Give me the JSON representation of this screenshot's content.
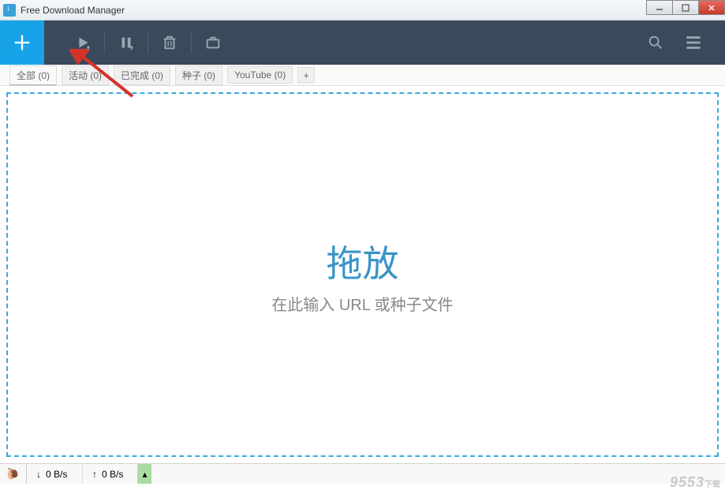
{
  "window": {
    "title": "Free Download Manager"
  },
  "toolbar": {
    "add": "add",
    "play": "start",
    "pause": "pause",
    "delete": "delete",
    "archive": "archive",
    "search": "search",
    "menu": "menu"
  },
  "tabs": [
    {
      "label": "全部 (0)",
      "active": true
    },
    {
      "label": "活动 (0)",
      "active": false
    },
    {
      "label": "已完成 (0)",
      "active": false
    },
    {
      "label": "种子 (0)",
      "active": false
    },
    {
      "label": "YouTube (0)",
      "active": false
    }
  ],
  "tab_add": "+",
  "dropzone": {
    "title": "拖放",
    "subtitle": "在此输入 URL 或种子文件"
  },
  "status": {
    "snail_icon": "🐌",
    "down_arrow": "↓",
    "down_speed": "0 B/s",
    "up_arrow": "↑",
    "up_speed": "0 B/s",
    "selector": "▴"
  },
  "watermark": {
    "main": "9553",
    "sub": "下载"
  }
}
